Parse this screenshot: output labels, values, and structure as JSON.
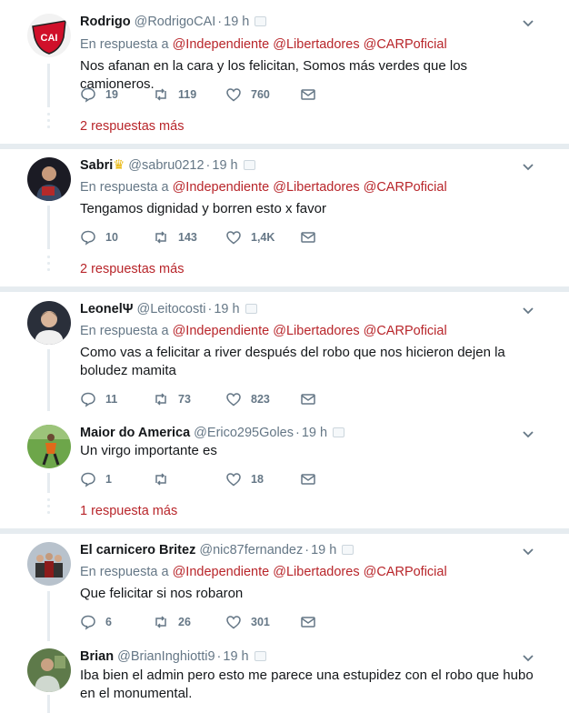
{
  "tweets": [
    {
      "name": "Rodrigo",
      "handle": "@RodrigoCAI",
      "time": "19 h",
      "reply_prefix": "En respuesta a",
      "mentions": [
        "@Independiente",
        "@Libertadores",
        "@CARPoficial"
      ],
      "text": "Nos afanan en la cara y los felicitan, Somos más verdes que los camioneros.",
      "replies": "19",
      "retweets": "119",
      "likes": "760",
      "more": "2 respuestas más",
      "avatar_icon": "independiente-crest-icon"
    },
    {
      "name": "Sabri",
      "handle": "@sabru0212",
      "time": "19 h",
      "reply_prefix": "En respuesta a",
      "mentions": [
        "@Independiente",
        "@Libertadores",
        "@CARPoficial"
      ],
      "text": "Tengamos dignidad y borren esto x favor",
      "replies": "10",
      "retweets": "143",
      "likes": "1,4K",
      "more": "2 respuestas más",
      "avatar_icon": "user-photo-icon"
    },
    {
      "name": "LeonelΨ",
      "handle": "@Leitocosti",
      "time": "19 h",
      "reply_prefix": "En respuesta a",
      "mentions": [
        "@Independiente",
        "@Libertadores",
        "@CARPoficial"
      ],
      "text": "Como vas a felicitar a river después del robo que nos hicieron dejen la boludez mamita",
      "replies": "11",
      "retweets": "73",
      "likes": "823",
      "avatar_icon": "user-photo-icon"
    },
    {
      "name": "Maior do America",
      "handle": "@Erico295Goles",
      "time": "19 h",
      "text": "Un virgo importante es",
      "replies": "1",
      "retweets": "",
      "likes": "18",
      "more": "1 respuesta más",
      "avatar_icon": "football-player-photo-icon"
    },
    {
      "name": "El carnicero Britez",
      "handle": "@nic87fernandez",
      "time": "19 h",
      "reply_prefix": "En respuesta a",
      "mentions": [
        "@Independiente",
        "@Libertadores",
        "@CARPoficial"
      ],
      "text": "Que felicitar si nos robaron",
      "replies": "6",
      "retweets": "26",
      "likes": "301",
      "avatar_icon": "team-photo-icon"
    },
    {
      "name": "Brian",
      "handle": "@BrianInghiotti9",
      "time": "19 h",
      "text": "Iba bien el admin pero esto me parece una estupidez con el robo que hubo en el monumental.",
      "avatar_icon": "user-photo-icon"
    }
  ],
  "colors": {
    "mention": "#b8252a",
    "secondary": "#657786",
    "border": "#e6ecf0"
  }
}
